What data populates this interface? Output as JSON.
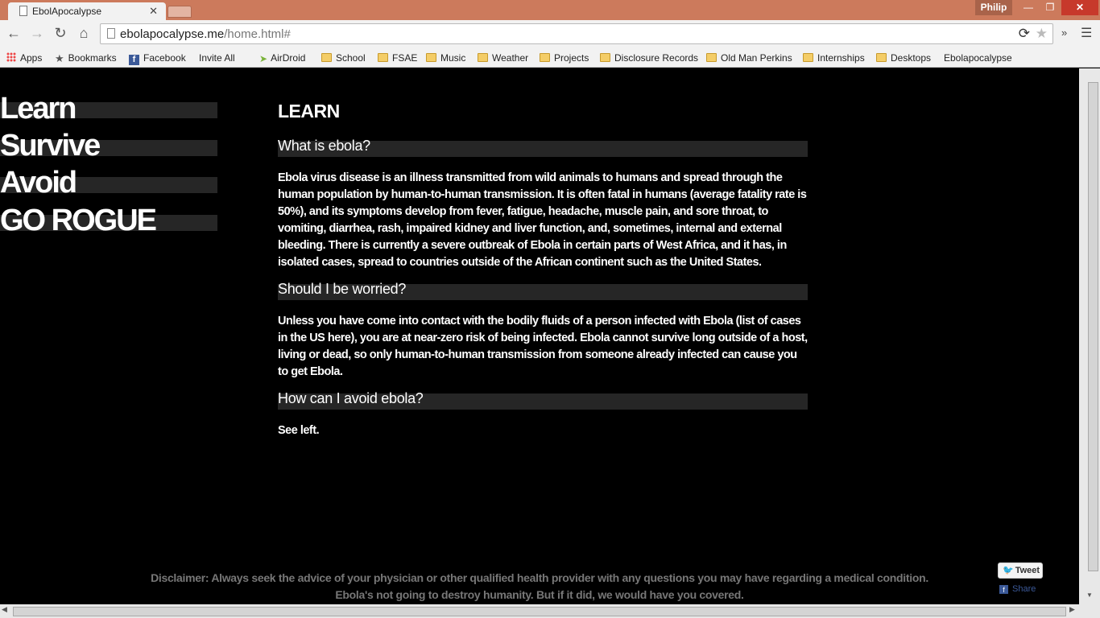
{
  "browser": {
    "tab_title": "EbolApocalypse",
    "user_name": "Philip",
    "url_host": "ebolapocalypse.me",
    "url_path": "/home.html#",
    "bookmarks": [
      "Apps",
      "Bookmarks",
      "Facebook",
      "Invite All",
      "AirDroid",
      "School",
      "FSAE",
      "Music",
      "Weather",
      "Projects",
      "Disclosure Records",
      "Old Man Perkins",
      "Internships",
      "Desktops",
      "Ebolapocalypse"
    ]
  },
  "sidebar": {
    "items": [
      "Learn",
      "Survive",
      "Avoid",
      "GO ROGUE"
    ]
  },
  "content": {
    "heading": "LEARN",
    "sections": [
      {
        "title": "What is ebola?",
        "lead": "Ebola virus disease",
        "body": " is an illness transmitted from wild animals to humans and spread through the human population by human-to-human transmission. It is often fatal in humans (average fatality rate is 50%), and its symptoms develop from fever, fatigue, headache, muscle pain, and sore throat, to vomiting, diarrhea, rash, impaired kidney and liver function, and, sometimes, internal and external bleeding. There is currently a severe outbreak of Ebola in certain parts of West Africa, and it has, in isolated cases, spread to countries outside of the African continent such as the United States."
      },
      {
        "title": "Should I be worried?",
        "body": "Unless you have come into contact with the bodily fluids of a person infected with Ebola (list of cases in the US here), you are at near-zero risk of being infected. Ebola cannot survive long outside of a host, living or dead, so only human-to-human transmission from someone already infected can cause you to get Ebola."
      },
      {
        "title": "How can I avoid ebola?",
        "body": "See left."
      }
    ]
  },
  "footer": {
    "disclaimer_line1": "Disclaimer: Always seek the advice of your physician or other qualified health provider with any questions you may have regarding a medical condition.",
    "disclaimer_line2": "Ebola's not going to destroy humanity. But if it did, we would have you covered."
  },
  "social": {
    "tweet_label": "Tweet",
    "share_label": "Share"
  },
  "colors": {
    "titlebar": "#cc7a5c",
    "page_background": "#000000",
    "bar_gray": "#262626",
    "text": "#ffffff",
    "disclaimer_text": "#777777"
  }
}
